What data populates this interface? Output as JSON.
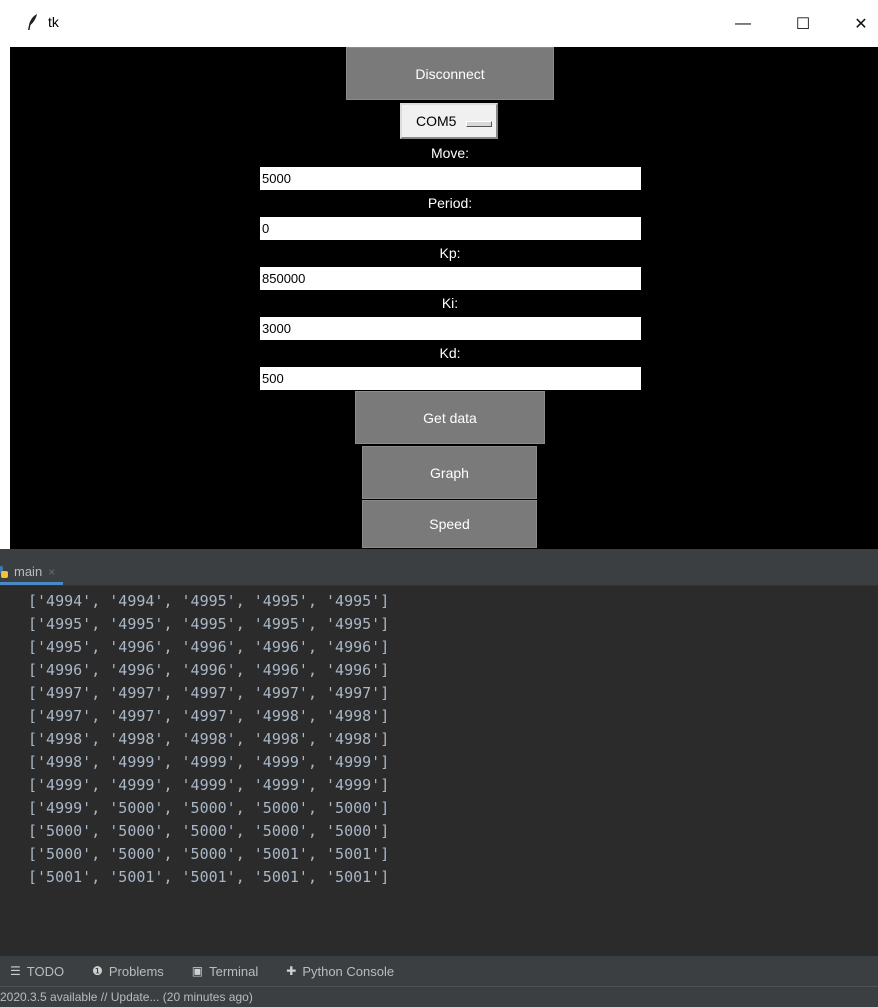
{
  "window": {
    "title": "tk",
    "minimize_glyph": "—",
    "maximize_glyph": "☐",
    "close_glyph": "✕"
  },
  "controls": {
    "disconnect_label": "Disconnect",
    "port_value": "COM5",
    "move_label": "Move:",
    "move_value": "5000",
    "period_label": "Period:",
    "period_value": "0",
    "kp_label": "Kp:",
    "kp_value": "850000",
    "ki_label": "Ki:",
    "ki_value": "3000",
    "kd_label": "Kd:",
    "kd_value": "500",
    "get_data_label": "Get data",
    "graph_label": "Graph",
    "speed_label": "Speed"
  },
  "run_tab": {
    "label": "main",
    "close_glyph": "×"
  },
  "console_lines": [
    "['4994', '4994', '4995', '4995', '4995']",
    "['4995', '4995', '4995', '4995', '4995']",
    "['4995', '4996', '4996', '4996', '4996']",
    "['4996', '4996', '4996', '4996', '4996']",
    "['4997', '4997', '4997', '4997', '4997']",
    "['4997', '4997', '4997', '4998', '4998']",
    "['4998', '4998', '4998', '4998', '4998']",
    "['4998', '4999', '4999', '4999', '4999']",
    "['4999', '4999', '4999', '4999', '4999']",
    "['4999', '5000', '5000', '5000', '5000']",
    "['5000', '5000', '5000', '5000', '5000']",
    "['5000', '5000', '5000', '5001', '5001']",
    "['5001', '5001', '5001', '5001', '5001']"
  ],
  "tool_windows": {
    "todo": "TODO",
    "problems": "Problems",
    "terminal": "Terminal",
    "python_console": "Python Console"
  },
  "status": {
    "text": "2020.3.5 available // Update... (20 minutes ago)"
  },
  "colors": {
    "tk_background": "#000000",
    "tk_button": "#7a7a7a",
    "ide_background": "#2b2b2b",
    "console_text": "#a9b7c6",
    "tab_underline": "#4a88c7"
  }
}
